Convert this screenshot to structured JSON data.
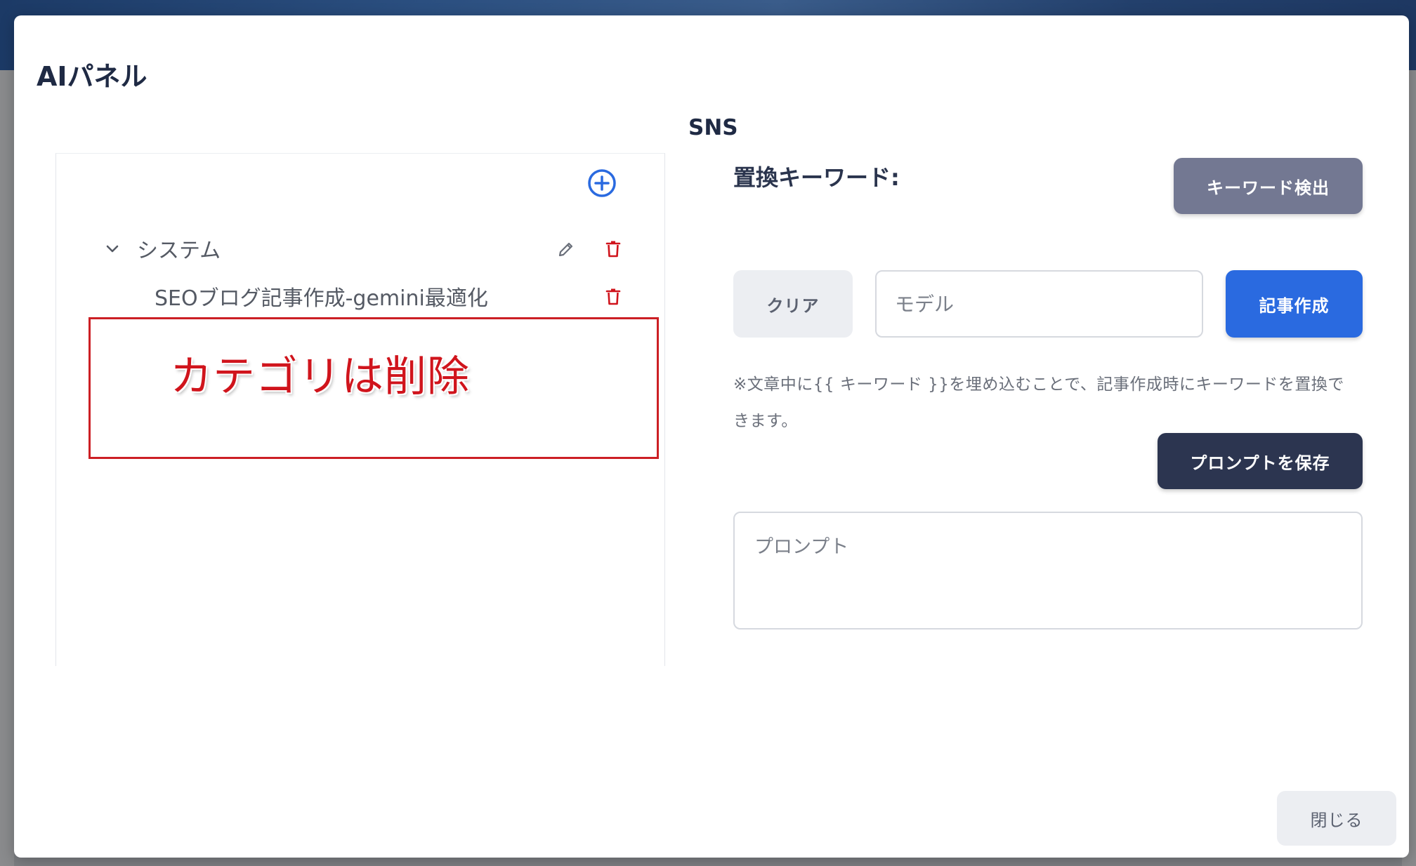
{
  "modal": {
    "title": "AIパネル",
    "section_title": "SNS",
    "close_label": "閉じる"
  },
  "tree": {
    "category_label": "システム",
    "item_label": "SEOブログ記事作成-gemini最適化"
  },
  "annotation": {
    "text": "カテゴリは削除",
    "color": "#d0141c"
  },
  "keywords": {
    "label": "置換キーワード:",
    "detect_button": "キーワード検出"
  },
  "controls": {
    "clear_button": "クリア",
    "model_placeholder": "モデル",
    "create_button": "記事作成",
    "hint_line1": "※文章中に{{ キーワード }}を埋め込むことで、記事作成時にキーワードを置換で",
    "hint_line2": "きます。",
    "save_button": "プロンプトを保存",
    "prompt_placeholder": "プロンプト"
  },
  "colors": {
    "primary": "#2a6ae0",
    "dark": "#2c3550",
    "muted_button": "#737892",
    "danger": "#d0141c"
  },
  "icons": {
    "add": "plus-circle-icon",
    "expand": "chevron-down-icon",
    "edit": "pencil-icon",
    "delete": "trash-icon"
  }
}
